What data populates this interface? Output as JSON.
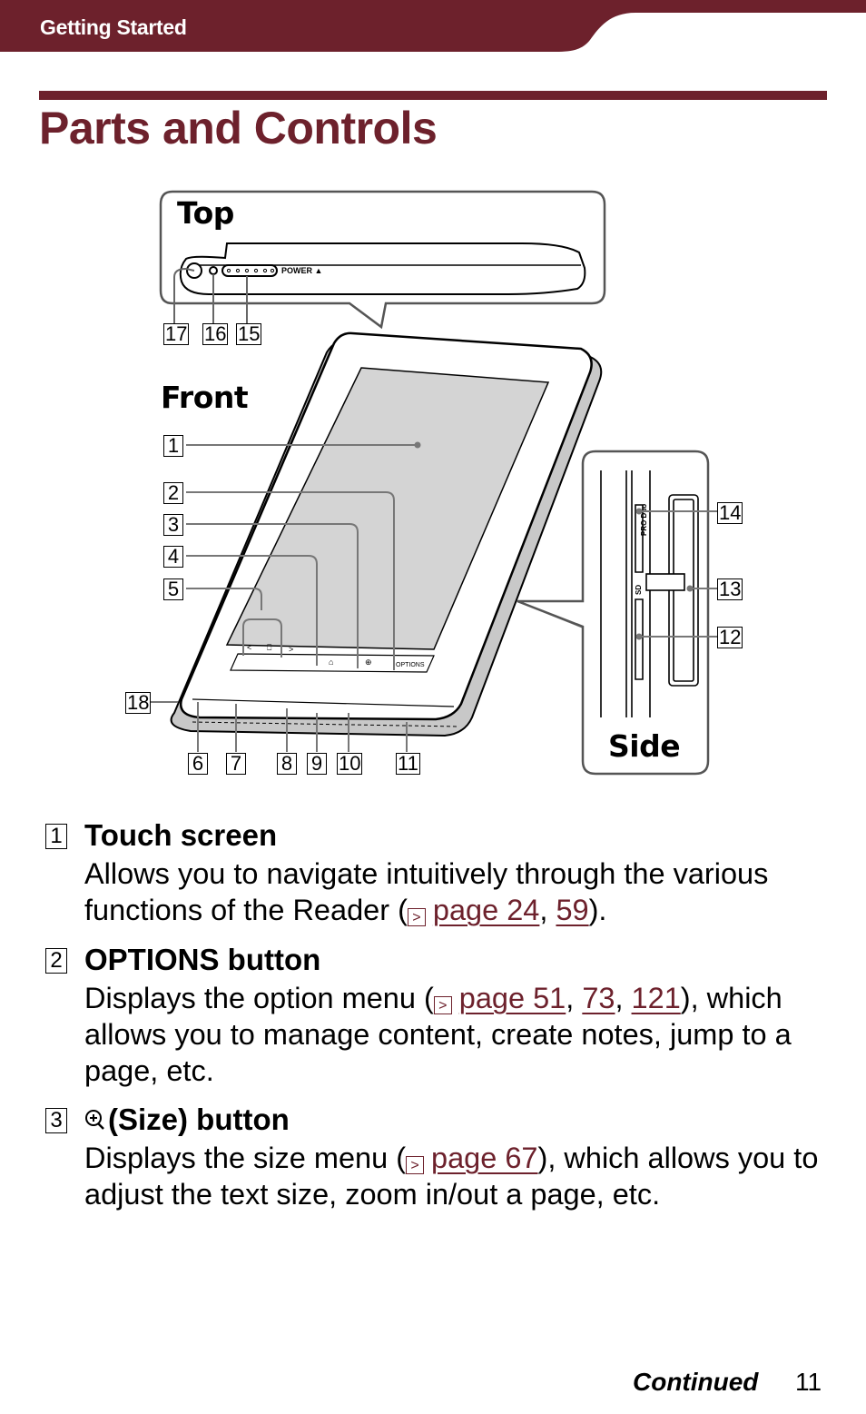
{
  "header": {
    "section": "Getting Started",
    "accent_color": "#6d212c"
  },
  "page_title": "Parts and Controls",
  "diagram": {
    "views": {
      "top": "Top",
      "front": "Front",
      "side": "Side"
    },
    "top_markings": {
      "power_label": "POWER"
    },
    "front_buttons": {
      "prev": "<",
      "book": "&#x1F56E;",
      "next": ">",
      "options": "OPTIONS"
    },
    "side_markings": {
      "pro_duo": "PRO Duo",
      "sd": "SD"
    },
    "callouts": [
      "1",
      "2",
      "3",
      "4",
      "5",
      "6",
      "7",
      "8",
      "9",
      "10",
      "11",
      "12",
      "13",
      "14",
      "15",
      "16",
      "17",
      "18"
    ]
  },
  "items": [
    {
      "number": "1",
      "title": "Touch screen",
      "body_pre": "Allows you to navigate intuitively through the various functions of the Reader (",
      "refs": [
        "page 24",
        "59"
      ],
      "body_post": ")."
    },
    {
      "number": "2",
      "title": "OPTIONS button",
      "body_pre": "Displays the option menu (",
      "refs": [
        "page 51",
        "73",
        "121"
      ],
      "body_post": "), which allows you to manage content, create notes, jump to a page, etc."
    },
    {
      "number": "3",
      "title_icon": "size-zoom-icon",
      "title": "(Size) button",
      "body_pre": "Displays the size menu (",
      "refs": [
        "page 67"
      ],
      "body_post": "), which allows you to adjust the text size, zoom in/out a page, etc."
    }
  ],
  "ref_icon_glyph": ">",
  "footer": {
    "continued": "Continued",
    "page_number": "11"
  }
}
